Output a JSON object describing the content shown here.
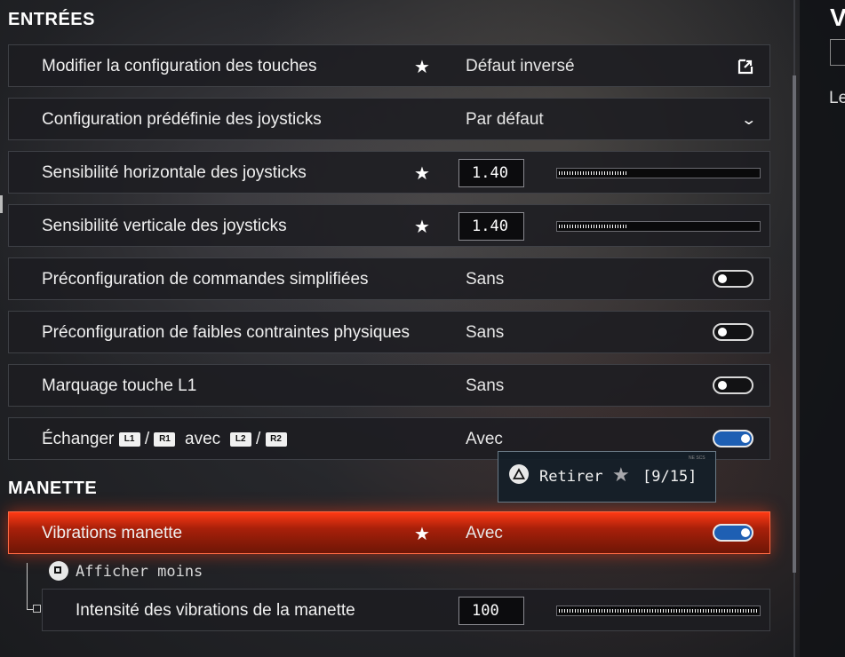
{
  "sections": {
    "inputs_title": "ENTRÉES",
    "controller_title": "MANETTE"
  },
  "rows": [
    {
      "label": "Modifier la configuration des touches",
      "starred": true,
      "value": "Défaut inversé",
      "control": "external-link"
    },
    {
      "label": "Configuration prédéfinie des joysticks",
      "starred": false,
      "value": "Par défaut",
      "control": "dropdown"
    },
    {
      "label": "Sensibilité horizontale des joysticks",
      "starred": true,
      "value": "1.40",
      "control": "slider",
      "slider_fraction": 0.35
    },
    {
      "label": "Sensibilité verticale des joysticks",
      "starred": true,
      "value": "1.40",
      "control": "slider",
      "slider_fraction": 0.35
    },
    {
      "label": "Préconfiguration de commandes simplifiées",
      "starred": false,
      "value": "Sans",
      "control": "toggle",
      "on": false
    },
    {
      "label": "Préconfiguration de faibles contraintes physiques",
      "starred": false,
      "value": "Sans",
      "control": "toggle",
      "on": false
    },
    {
      "label": "Marquage touche L1",
      "starred": false,
      "value": "Sans",
      "control": "toggle",
      "on": false
    }
  ],
  "swap_row": {
    "prefix": "Échanger",
    "btn1": "L1",
    "slash": "/",
    "btn2": "R1",
    "middle": "avec",
    "btn3": "L2",
    "btn4": "R2",
    "value": "Avec",
    "on": true
  },
  "vibration_row": {
    "label": "Vibrations manette",
    "starred": true,
    "value": "Avec",
    "on": true
  },
  "intensity_row": {
    "label": "Intensité des vibrations de la manette",
    "value": "100",
    "slider_fraction": 1.0
  },
  "star_glyph": "★",
  "tooltip": {
    "action": "Retirer",
    "count": "[9/15]",
    "fine_print": "NE SCS"
  },
  "show_less": "Afficher moins",
  "right_panel": {
    "letter": "V",
    "text": "Le"
  },
  "colors": {
    "highlight": "#e0300f",
    "toggle_on": "#1e5fb3"
  }
}
